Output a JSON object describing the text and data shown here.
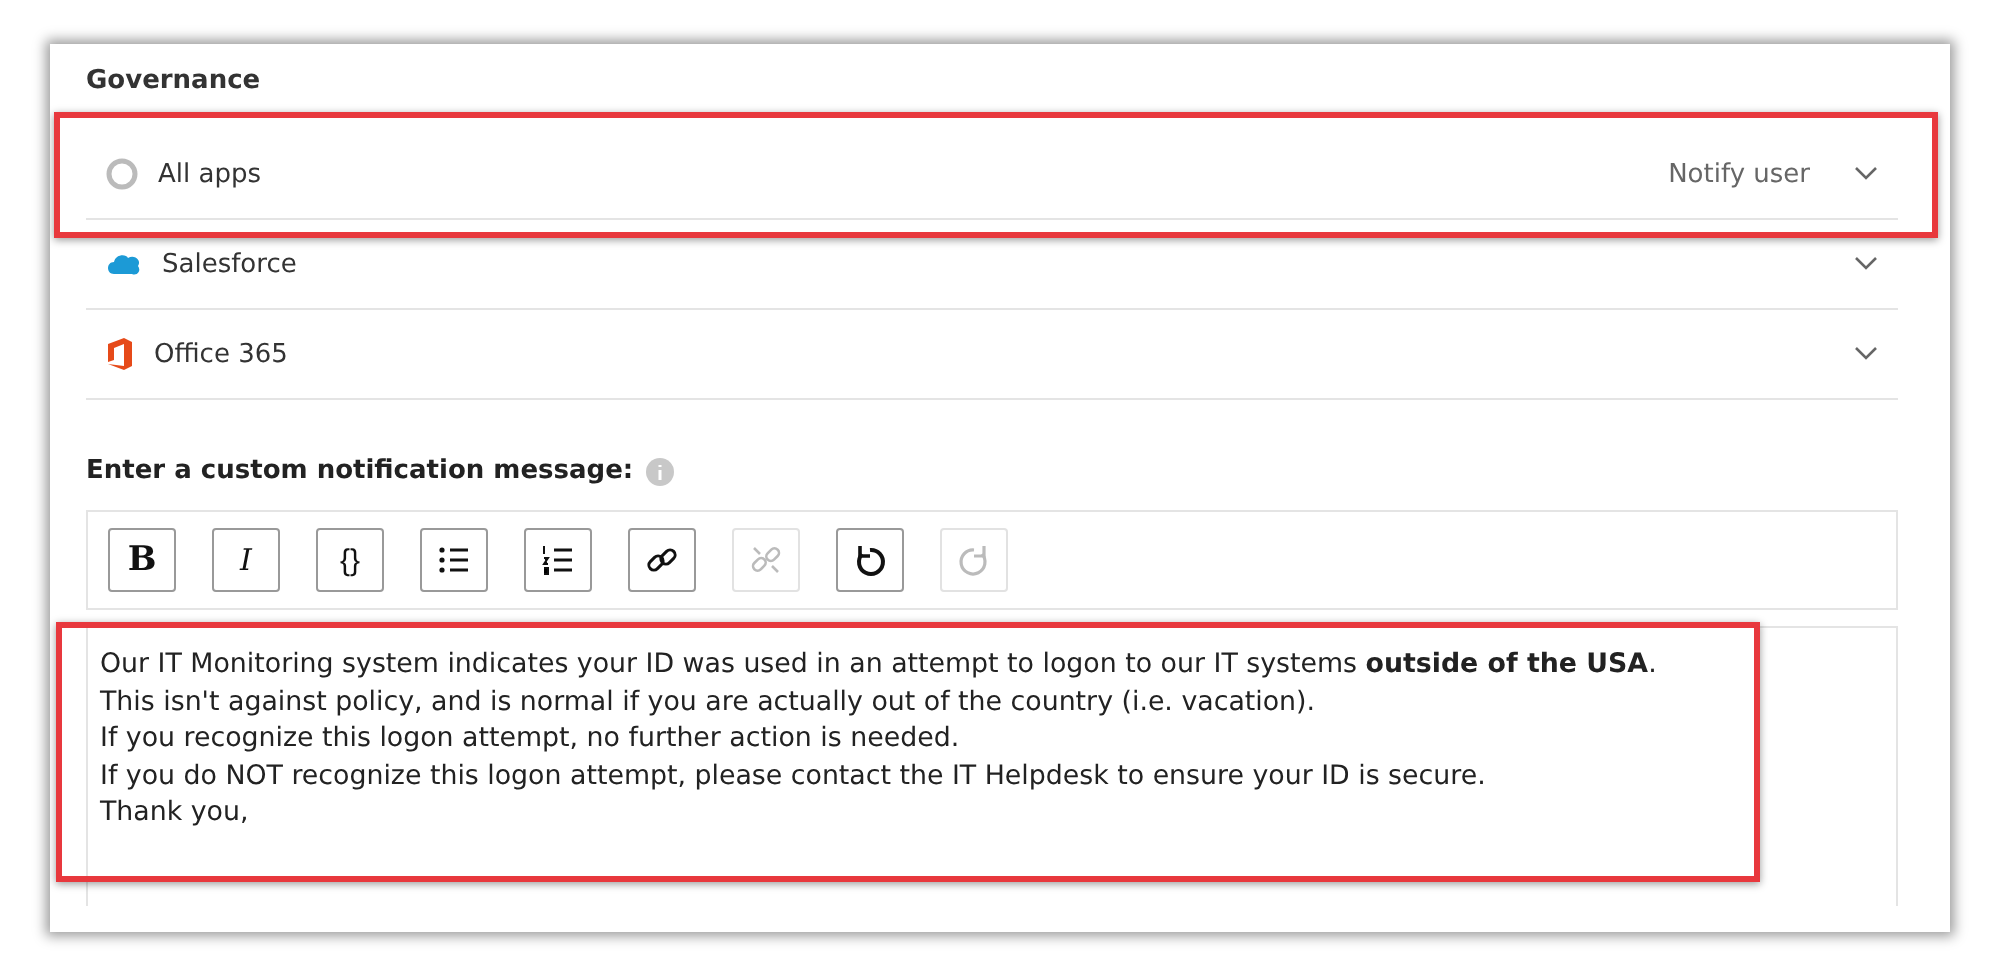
{
  "section": {
    "title": "Governance"
  },
  "apps": [
    {
      "name": "All apps",
      "kind": "circle",
      "action": "Notify user",
      "highlighted": true
    },
    {
      "name": "Salesforce",
      "kind": "cloud",
      "highlighted": false
    },
    {
      "name": "Office 365",
      "kind": "office",
      "highlighted": false
    }
  ],
  "message_label": "Enter a custom notification message:",
  "toolbar": [
    {
      "kind": "bold",
      "text": "B",
      "disabled": false
    },
    {
      "kind": "italic",
      "text": "I",
      "disabled": false
    },
    {
      "kind": "code",
      "text": "{}",
      "disabled": false
    },
    {
      "kind": "bullets",
      "disabled": false
    },
    {
      "kind": "numbers",
      "disabled": false
    },
    {
      "kind": "link",
      "disabled": false
    },
    {
      "kind": "unlink",
      "disabled": true
    },
    {
      "kind": "undo",
      "disabled": false
    },
    {
      "kind": "redo",
      "disabled": true
    }
  ],
  "message": {
    "highlighted": true,
    "lines": [
      "Our IT Monitoring system indicates your ID was used in an attempt to logon to our IT systems **outside of the USA**.",
      "This isn't against policy, and is normal if you are actually out of the country (i.e. vacation).",
      "If you recognize this logon attempt, no further action is needed.",
      "If you do NOT recognize this logon attempt, please contact the IT Helpdesk to ensure your ID is secure.",
      "Thank you,"
    ]
  }
}
